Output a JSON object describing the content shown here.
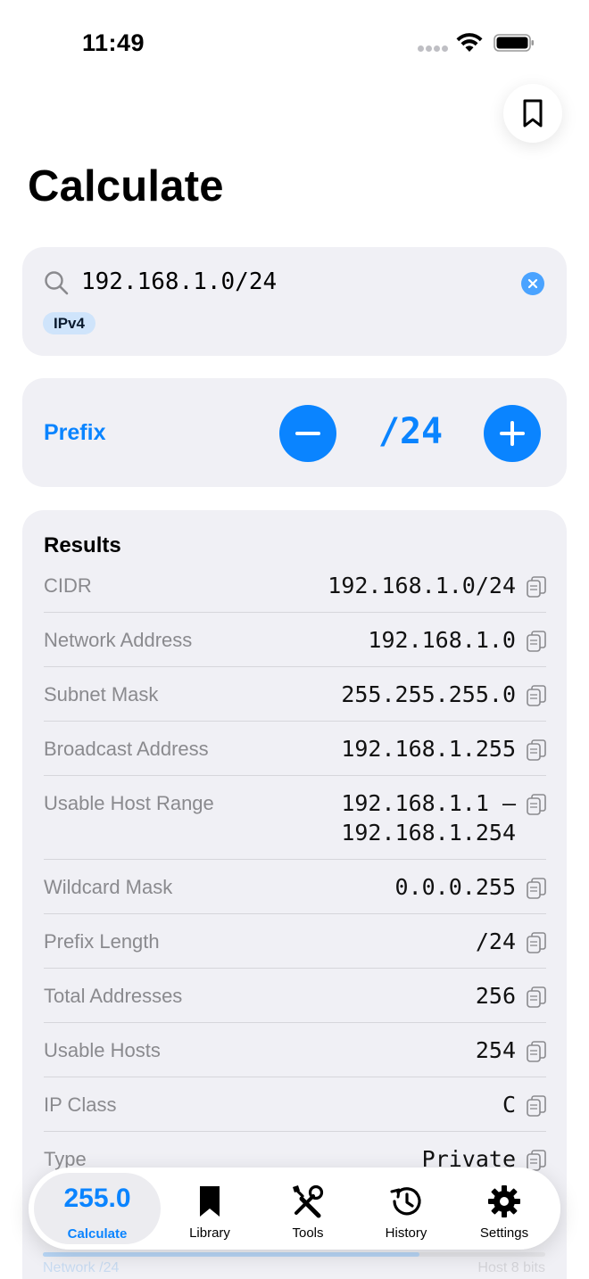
{
  "status_bar": {
    "time": "11:49"
  },
  "page": {
    "title": "Calculate"
  },
  "search": {
    "value": "192.168.1.0/24",
    "badge": "IPv4"
  },
  "prefix": {
    "label": "Prefix",
    "value": "/24"
  },
  "results": {
    "title": "Results",
    "rows": [
      {
        "label": "CIDR",
        "value": "192.168.1.0/24"
      },
      {
        "label": "Network Address",
        "value": "192.168.1.0"
      },
      {
        "label": "Subnet Mask",
        "value": "255.255.255.0"
      },
      {
        "label": "Broadcast Address",
        "value": "192.168.1.255"
      },
      {
        "label": "Usable Host Range",
        "value_line1": "192.168.1.1 –",
        "value_line2": "192.168.1.254"
      },
      {
        "label": "Wildcard Mask",
        "value": "0.0.0.255"
      },
      {
        "label": "Prefix Length",
        "value": "/24"
      },
      {
        "label": "Total Addresses",
        "value": "256"
      },
      {
        "label": "Usable Hosts",
        "value": "254"
      },
      {
        "label": "IP Class",
        "value": "C"
      },
      {
        "label": "Type",
        "value": "Private"
      }
    ]
  },
  "bottom_hint": {
    "left": "Network /24",
    "right": "Host 8 bits",
    "network_fraction": 0.75
  },
  "tab_bar": {
    "tabs": [
      {
        "label": "Calculate",
        "big": "255.0"
      },
      {
        "label": "Library",
        "icon": "bookmark-icon"
      },
      {
        "label": "Tools",
        "icon": "tools-icon"
      },
      {
        "label": "History",
        "icon": "history-icon"
      },
      {
        "label": "Settings",
        "icon": "gear-icon"
      }
    ]
  },
  "colors": {
    "accent": "#0a84ff",
    "card": "#f0f0f5",
    "label_gray": "#8a8a8e"
  }
}
